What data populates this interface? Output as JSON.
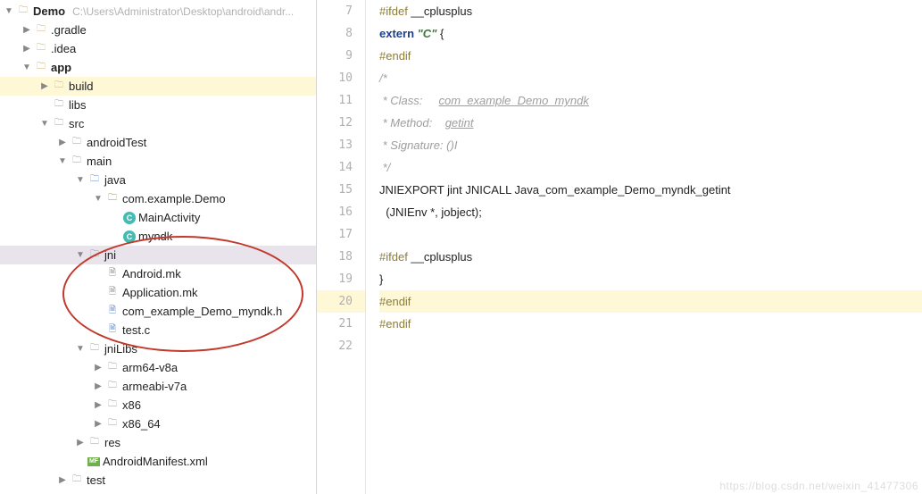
{
  "breadcrumb": {
    "root": "Demo",
    "path": "C:\\Users\\Administrator\\Desktop\\android\\andr..."
  },
  "tree": {
    "gradle": ".gradle",
    "idea": ".idea",
    "app": "app",
    "build": "build",
    "libs": "libs",
    "src": "src",
    "androidTest": "androidTest",
    "main": "main",
    "java": "java",
    "pkg": "com.example.Demo",
    "mainActivity": "MainActivity",
    "myndk": "myndk",
    "jni": "jni",
    "androidmk": "Android.mk",
    "appmk": "Application.mk",
    "header": "com_example_Demo_myndk.h",
    "testc": "test.c",
    "jniLibs": "jniLibs",
    "arm64": "arm64-v8a",
    "armeabi": "armeabi-v7a",
    "x86": "x86",
    "x86_64": "x86_64",
    "res": "res",
    "manifest": "AndroidManifest.xml",
    "test": "test"
  },
  "lines": [
    "7",
    "8",
    "9",
    "10",
    "11",
    "12",
    "13",
    "14",
    "15",
    "16",
    "17",
    "18",
    "19",
    "20",
    "21",
    "22"
  ],
  "code": {
    "l7a": "#ifdef",
    "l7b": " __cplusplus",
    "l8a": "extern",
    "l8b": " \"C\"",
    "l8c": " {",
    "l9": "#endif",
    "l10": "/*",
    "l11a": " * Class:     ",
    "l11b": "com_example_Demo_myndk",
    "l12a": " * Method:    ",
    "l12b": "getint",
    "l13": " * Signature: ()I",
    "l14": " */",
    "l15": "JNIEXPORT jint JNICALL Java_com_example_Demo_myndk_getint",
    "l16": "  (JNIEnv *, jobject);",
    "l17": "",
    "l18a": "#ifdef",
    "l18b": " __cplusplus",
    "l19": "}",
    "l20": "#endif",
    "l21": "#endif"
  },
  "watermark": "https://blog.csdn.net/weixin_41477306"
}
